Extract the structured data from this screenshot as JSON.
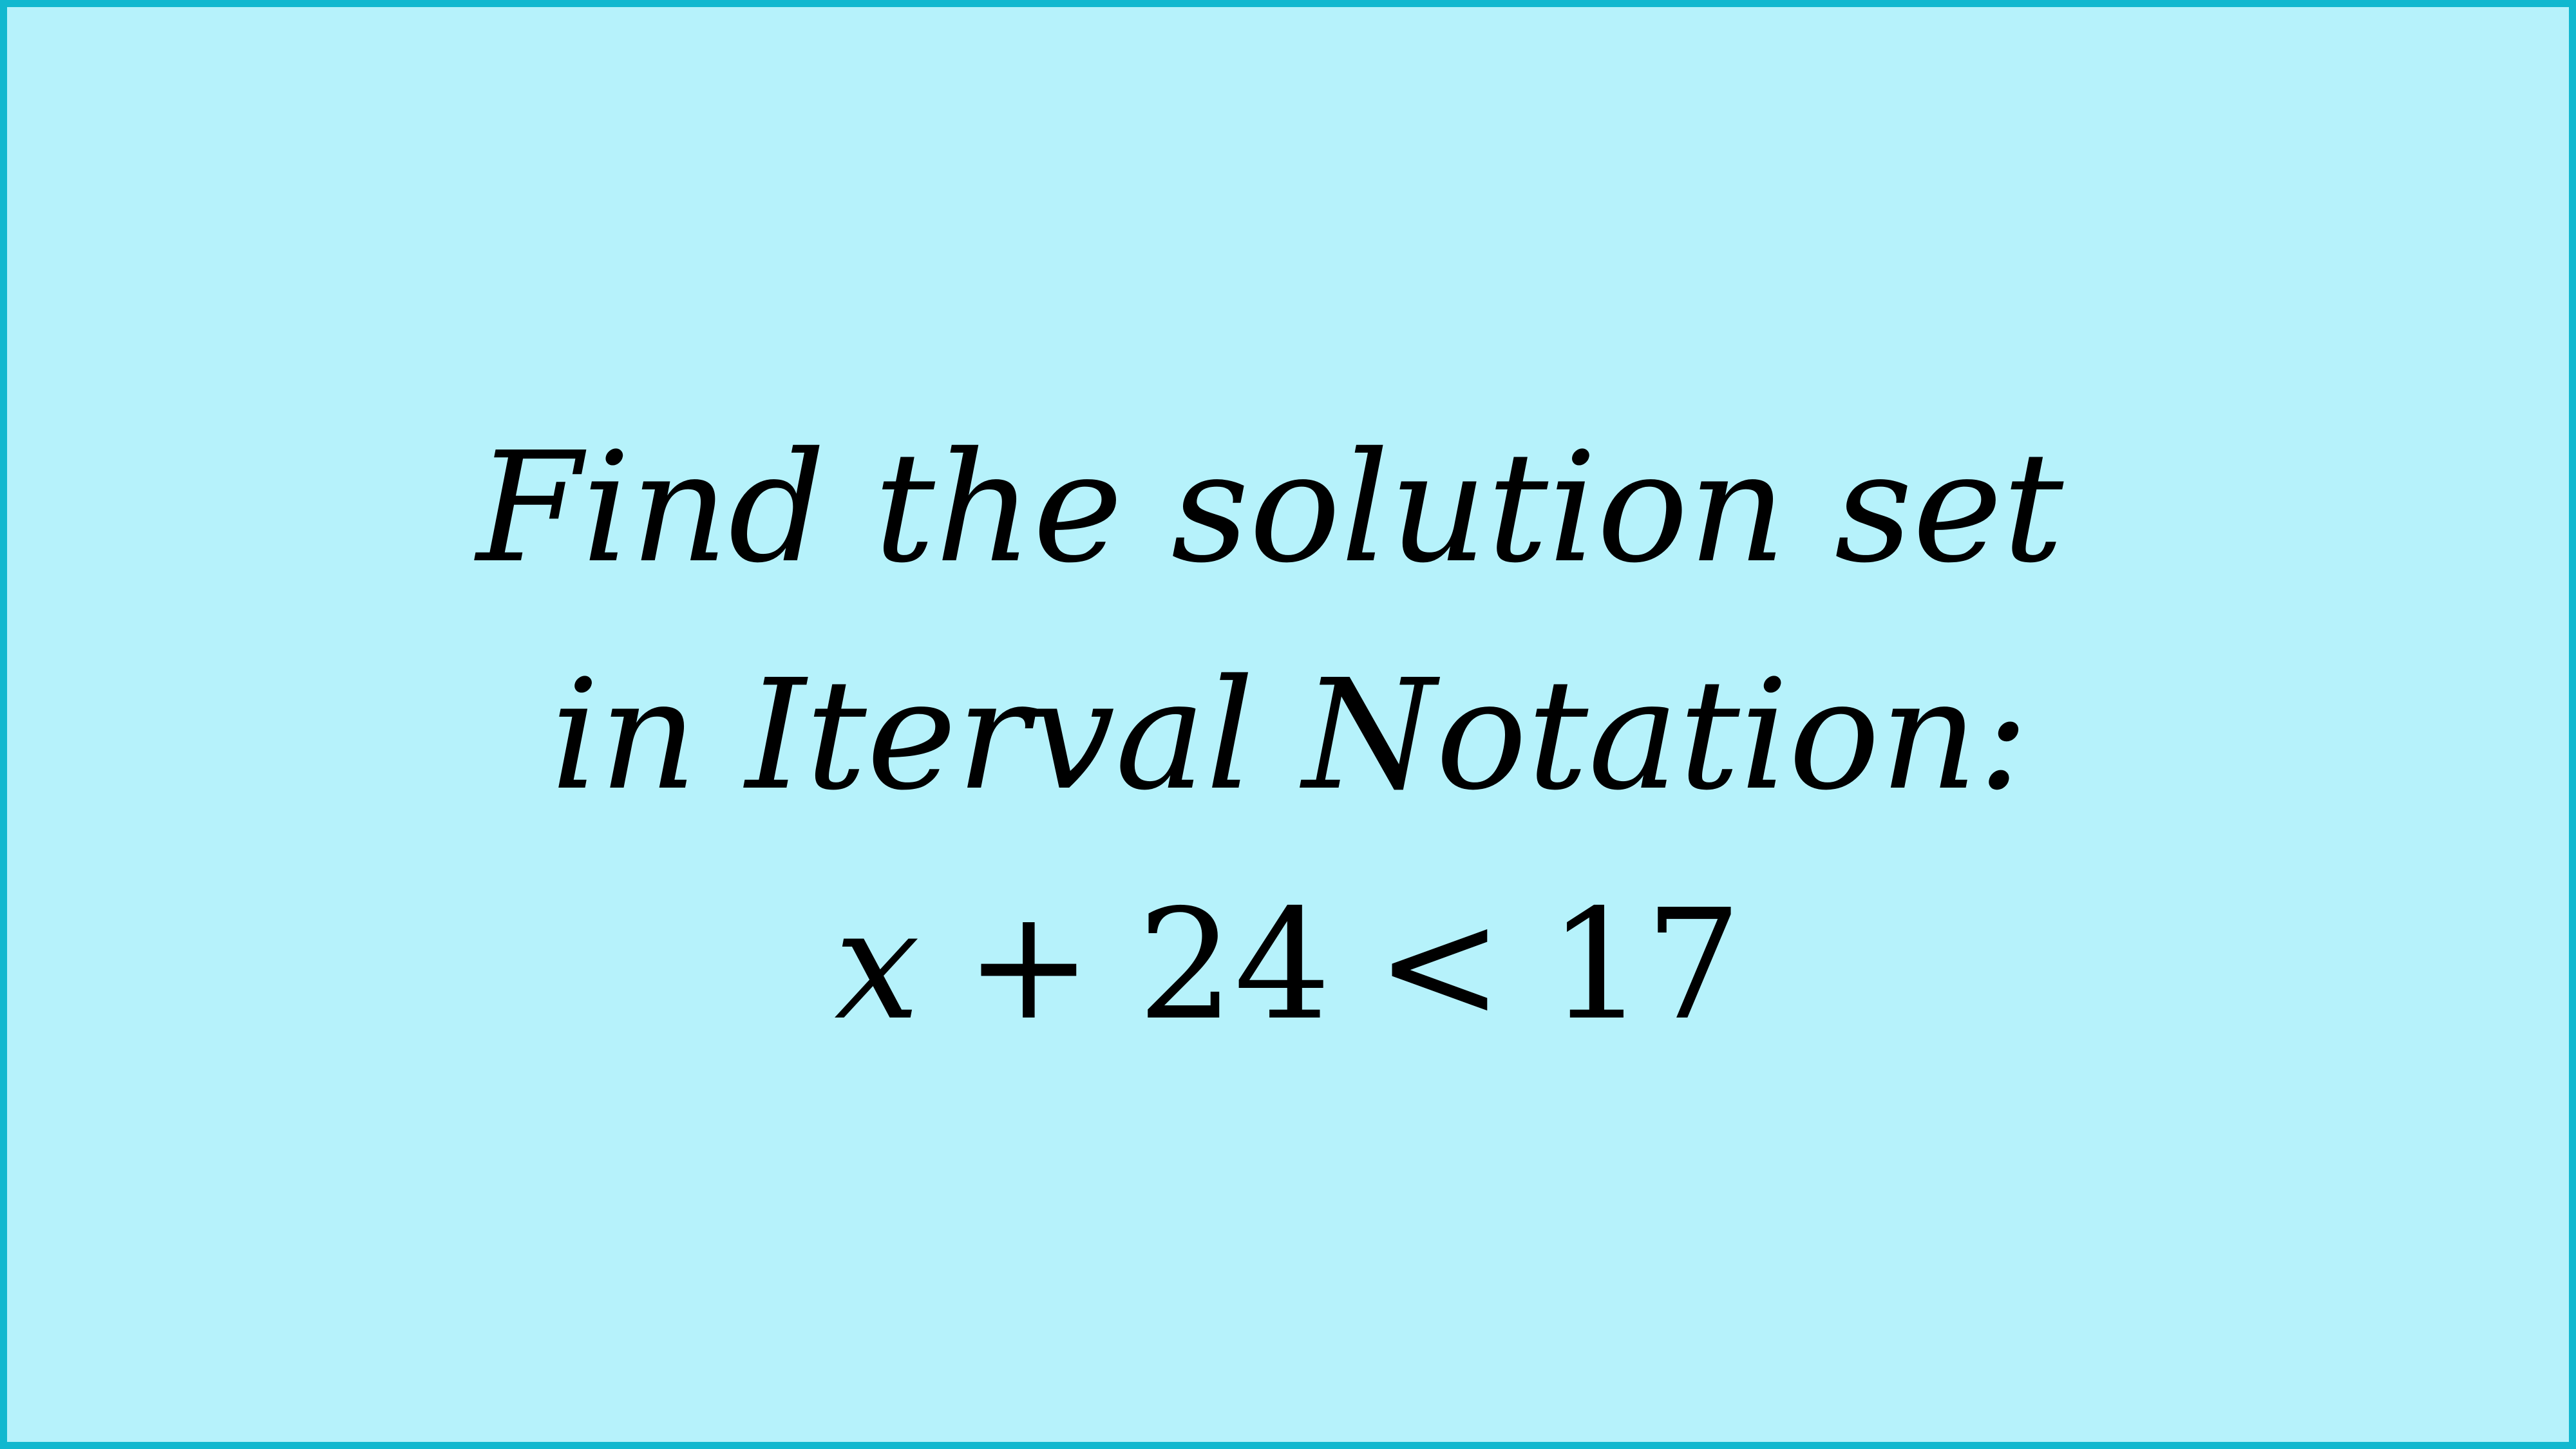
{
  "slide": {
    "background": "#b6f2fb",
    "border_color": "#11b8cf",
    "prompt_line_1": "Find the solution set",
    "prompt_line_2": "in Iterval Notation:",
    "equation": {
      "variable": "x",
      "plus": "+",
      "addend": "24",
      "relation": "<",
      "rhs": "17"
    }
  }
}
